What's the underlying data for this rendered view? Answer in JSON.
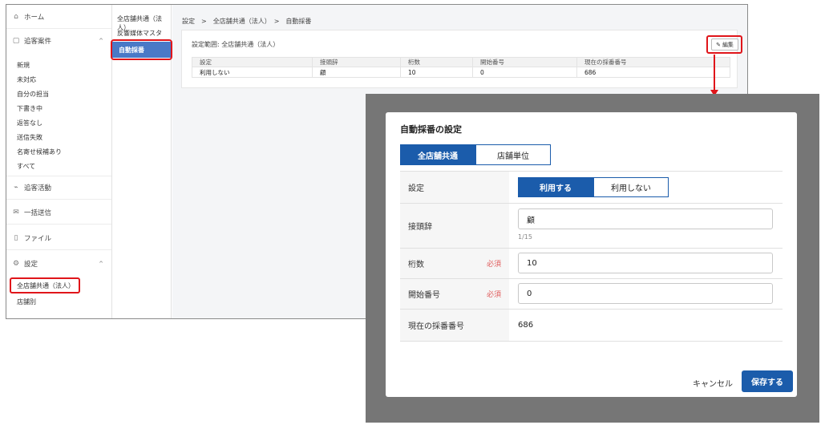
{
  "sidebar": {
    "home": "ホーム",
    "inquiries": "追客案件",
    "inquiry_items": [
      "新規",
      "未対応",
      "自分の担当",
      "下書き中",
      "返答なし",
      "送信失敗",
      "名寄せ候補あり",
      "すべて"
    ],
    "activities": "追客活動",
    "bulk_send": "一括送信",
    "files": "ファイル",
    "settings": "設定",
    "settings_items": [
      "全店舗共通（法人）",
      "店舗別"
    ]
  },
  "subnav": {
    "items": [
      "全店舗共通（法人）",
      "反響媒体マスタ",
      "自動採番"
    ]
  },
  "page": {
    "breadcrumb": "設定　>　全店舗共通（法人）　>　自動採番",
    "scope": "設定範囲: 全店舗共通（法人）",
    "edit_label": "編集",
    "table": {
      "headers": [
        "設定",
        "接頭辞",
        "桁数",
        "開始番号",
        "現在の採番番号"
      ],
      "row": [
        "利用しない",
        "顧",
        "10",
        "0",
        "686"
      ]
    }
  },
  "modal": {
    "title": "自動採番の設定",
    "tabs": [
      "全店舗共通",
      "店舗単位"
    ],
    "rows": {
      "setting_label": "設定",
      "setting_options": [
        "利用する",
        "利用しない"
      ],
      "prefix_label": "接頭辞",
      "prefix_value": "顧",
      "prefix_counter": "1/15",
      "digits_label": "桁数",
      "digits_value": "10",
      "start_label": "開始番号",
      "start_value": "0",
      "current_label": "現在の採番番号",
      "current_value": "686",
      "required": "必須"
    },
    "cancel": "キャンセル",
    "save": "保存する"
  },
  "colors": {
    "accent": "#1b5cab",
    "highlight": "#e0151a",
    "required": "#e05b5b"
  }
}
